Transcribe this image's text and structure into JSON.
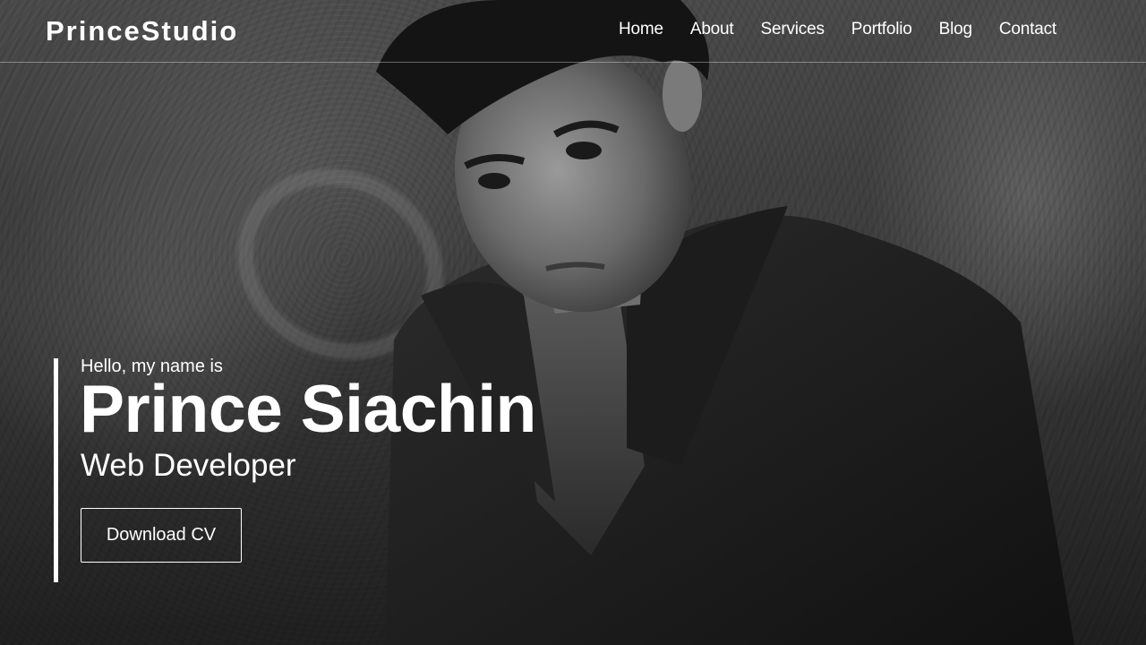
{
  "brand": {
    "name": "PrinceStudio"
  },
  "nav": {
    "items": [
      {
        "label": "Home"
      },
      {
        "label": "About"
      },
      {
        "label": "Services"
      },
      {
        "label": "Portfolio"
      },
      {
        "label": "Blog"
      },
      {
        "label": "Contact"
      }
    ]
  },
  "hero": {
    "greeting": "Hello, my name is",
    "name": "Prince Siachin",
    "role": "Web Developer",
    "cta_label": "Download CV",
    "background_image": "black-and-white portrait photo"
  },
  "colors": {
    "text": "#ffffff",
    "accent": "#ffffff"
  }
}
